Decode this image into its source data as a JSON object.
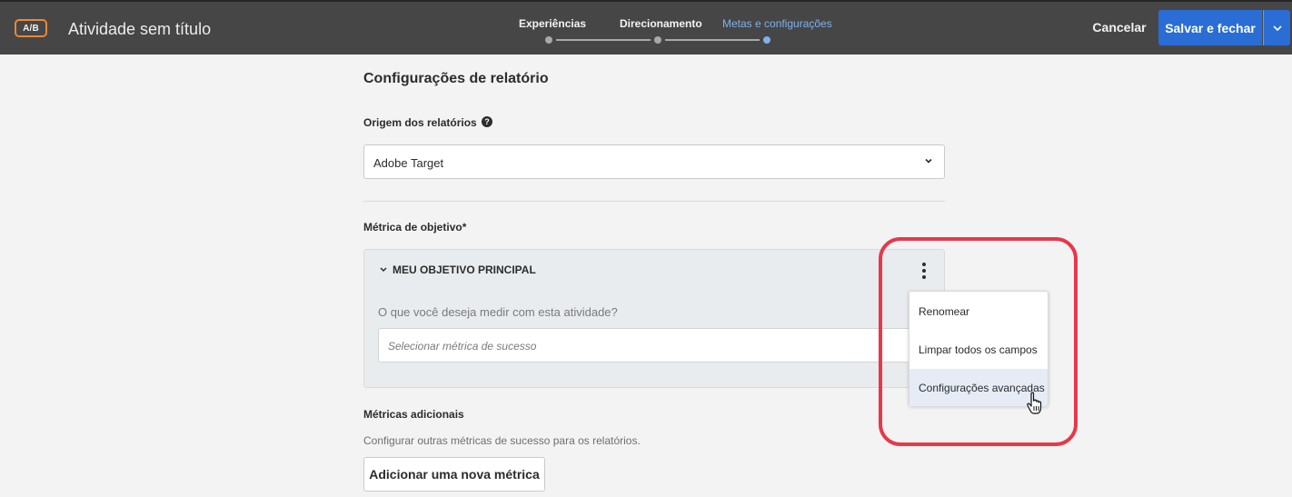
{
  "header": {
    "badge": "A/B",
    "title": "Atividade sem título",
    "steps": [
      {
        "label": "Experiências",
        "active": false
      },
      {
        "label": "Direcionamento",
        "active": false
      },
      {
        "label": "Metas e configurações",
        "active": true
      }
    ],
    "cancel_label": "Cancelar",
    "save_label": "Salvar e fechar"
  },
  "main": {
    "section_title": "Configurações de relatório",
    "report_source_label": "Origem dos relatórios",
    "help_icon": "?",
    "report_source_value": "Adobe Target",
    "goal_metric_label": "Métrica de objetivo*",
    "goal": {
      "title": "MEU OBJETIVO PRINCIPAL",
      "question": "O que você deseja medir com esta atividade?",
      "metric_placeholder": "Selecionar métrica de sucesso"
    },
    "additional_label": "Métricas adicionais",
    "additional_helper": "Configurar outras métricas de sucesso para os relatórios.",
    "add_button_label": "Adicionar uma nova métrica"
  },
  "menu": {
    "items": [
      "Renomear",
      "Limpar todos os campos",
      "Configurações avançadas"
    ],
    "hovered": 2
  },
  "colors": {
    "topbar": "#464646",
    "primary": "#2a6dd5",
    "active_step": "#7fb1ee",
    "badge_border": "#e8883b",
    "highlight": "#e5394b"
  },
  "icons": [
    "chevron-down-icon",
    "help-icon",
    "more-vertical-icon",
    "hand-cursor-icon"
  ]
}
